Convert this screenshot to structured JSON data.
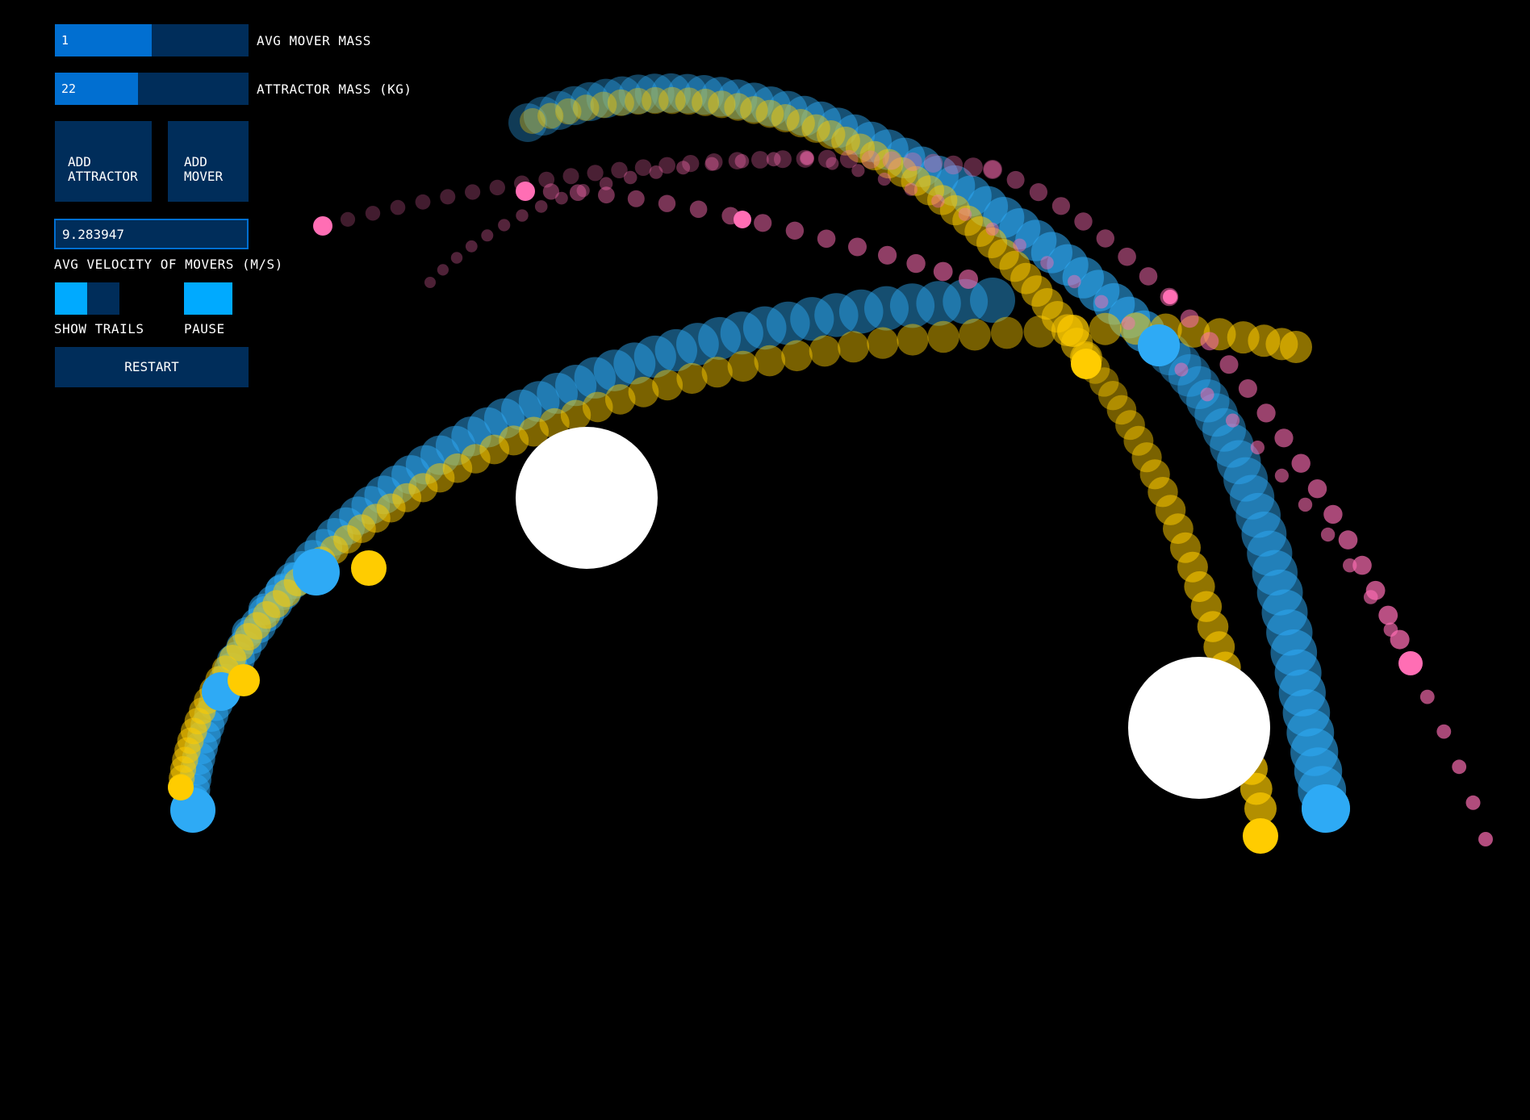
{
  "controls": {
    "avg_mover_mass": {
      "value": "1",
      "label": "AVG MOVER MASS",
      "fill_fraction": 0.5
    },
    "attractor_mass": {
      "value": "22",
      "label": "ATTRACTOR MASS (KG)",
      "fill_fraction": 0.43
    },
    "add_attractor": {
      "line1": "ADD",
      "line2": "ATTRACTOR"
    },
    "add_mover": {
      "line1": "ADD",
      "line2": "MOVER"
    },
    "avg_velocity": {
      "value": "9.283947",
      "label": "AVG VELOCITY OF MOVERS (M/S)"
    },
    "show_trails": {
      "label": "SHOW TRAILS",
      "on": true
    },
    "pause": {
      "label": "PAUSE",
      "on": true
    },
    "restart": {
      "label": "RESTART"
    }
  },
  "colors": {
    "background": "#000000",
    "panel": "#002d5a",
    "accent": "#016fd1",
    "toggle_on": "#00aaff",
    "attractor": "#ffffff",
    "mover_blue": "#2eaaf5",
    "mover_yellow": "#ffcc00",
    "mover_pink": "#ff6eb4"
  }
}
